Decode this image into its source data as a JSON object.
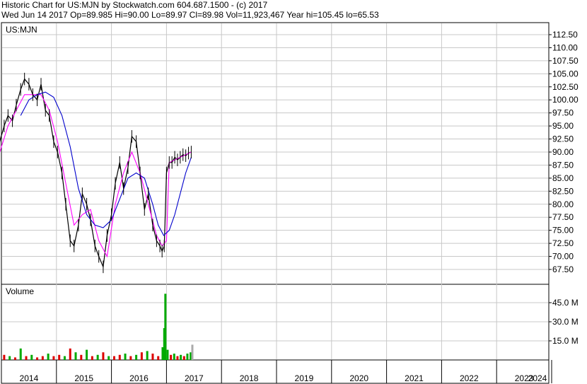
{
  "header": {
    "line1": "Historic Chart for US:MJN by Stockwatch.com 604.687.1500 - (c) 2017",
    "line2": "Wed Jun 14 2017   Op=89.985  Hi=90.00  Lo=89.97  Cl=89.98  Vol=11,923,467  Year hi=105.45  lo=65.53"
  },
  "colors": {
    "price": "#000000",
    "ma_short": "#ff00ff",
    "ma_long": "#0000cc",
    "volume_up": "#00aa00",
    "volume_down": "#dd0000",
    "volume_last": "#aaaaaa",
    "grid": "#c8c8c8"
  },
  "chart_data": [
    {
      "type": "line",
      "title": "US:MJN",
      "ylim": [
        65.53,
        113.5
      ],
      "yticks": [
        "112.50",
        "110.00",
        "107.50",
        "105.00",
        "102.50",
        "100.00",
        "97.50",
        "95.00",
        "92.50",
        "90.00",
        "87.50",
        "85.00",
        "82.50",
        "80.00",
        "77.50",
        "75.00",
        "72.50",
        "70.00",
        "67.50"
      ],
      "x_labels": [
        "2014",
        "2015",
        "2016",
        "2017",
        "2018",
        "2019",
        "2020",
        "2021",
        "2022",
        "2023",
        "2024"
      ],
      "series": [
        {
          "role": "price",
          "x": [
            2013.83,
            2013.9,
            2013.97,
            2014.05,
            2014.12,
            2014.2,
            2014.27,
            2014.35,
            2014.42,
            2014.5,
            2014.57,
            2014.65,
            2014.72,
            2014.8,
            2014.87,
            2014.95,
            2015.02,
            2015.1,
            2015.17,
            2015.25,
            2015.32,
            2015.4,
            2015.47,
            2015.55,
            2015.62,
            2015.7,
            2015.77,
            2015.85,
            2015.92,
            2016.0,
            2016.07,
            2016.15,
            2016.22,
            2016.3,
            2016.37,
            2016.45,
            2016.52,
            2016.6,
            2016.67,
            2016.75,
            2016.82,
            2016.88,
            2016.92,
            2016.96,
            2017.0,
            2017.05,
            2017.1,
            2017.15,
            2017.2,
            2017.25,
            2017.3,
            2017.35,
            2017.4,
            2017.45
          ],
          "y": [
            86,
            88,
            92,
            95,
            97,
            96,
            99,
            102,
            104,
            103,
            101,
            100,
            103,
            98,
            97,
            92,
            90,
            86,
            80,
            73,
            72,
            76,
            82,
            80,
            77,
            72,
            70,
            68,
            74,
            78,
            84,
            88,
            83,
            87,
            93,
            92,
            86,
            79,
            82,
            76,
            73,
            72,
            71,
            72,
            86,
            88,
            88,
            89,
            88.5,
            89,
            89.5,
            89.3,
            89.8,
            90
          ]
        },
        {
          "role": "ma_short",
          "x": [
            2013.83,
            2013.97,
            2014.12,
            2014.27,
            2014.42,
            2014.57,
            2014.72,
            2014.87,
            2015.02,
            2015.17,
            2015.32,
            2015.47,
            2015.62,
            2015.77,
            2015.92,
            2016.07,
            2016.22,
            2016.37,
            2016.52,
            2016.67,
            2016.82,
            2016.92,
            2017.0,
            2017.05,
            2017.15,
            2017.25,
            2017.35,
            2017.45
          ],
          "y": [
            85,
            90,
            95,
            98,
            101,
            101,
            101,
            98,
            92,
            84,
            76,
            78,
            79,
            73,
            70,
            80,
            86,
            90,
            86,
            80,
            74,
            72,
            73,
            88,
            88.5,
            89,
            89.5,
            90
          ]
        },
        {
          "role": "ma_long",
          "x": [
            2014.35,
            2014.5,
            2014.65,
            2014.8,
            2014.95,
            2015.1,
            2015.25,
            2015.4,
            2015.55,
            2015.7,
            2015.85,
            2016.0,
            2016.15,
            2016.3,
            2016.45,
            2016.6,
            2016.75,
            2016.85,
            2016.95,
            2017.05,
            2017.15,
            2017.25,
            2017.35,
            2017.45
          ],
          "y": [
            97,
            100,
            101,
            101.5,
            100.5,
            97,
            91,
            83,
            78,
            76,
            75.5,
            77,
            81,
            85,
            86,
            85,
            80,
            76,
            74,
            75,
            78,
            82,
            86,
            89
          ]
        }
      ]
    },
    {
      "type": "bar",
      "title": "Volume",
      "ylim": [
        0,
        55
      ],
      "yticks": [
        "45.0 M",
        "30.0 M",
        "15.0 M"
      ],
      "x": [
        2013.85,
        2013.95,
        2014.05,
        2014.15,
        2014.25,
        2014.35,
        2014.45,
        2014.55,
        2014.65,
        2014.75,
        2014.85,
        2014.95,
        2015.05,
        2015.15,
        2015.25,
        2015.35,
        2015.45,
        2015.55,
        2015.65,
        2015.75,
        2015.85,
        2015.95,
        2016.05,
        2016.15,
        2016.25,
        2016.35,
        2016.45,
        2016.55,
        2016.65,
        2016.75,
        2016.85,
        2016.93,
        2016.96,
        2016.98,
        2017.02,
        2017.08,
        2017.14,
        2017.2,
        2017.26,
        2017.32,
        2017.38,
        2017.44,
        2017.47
      ],
      "values": [
        3,
        2,
        4,
        3,
        2,
        9,
        3,
        4,
        2,
        3,
        5,
        3,
        4,
        3,
        9,
        6,
        4,
        8,
        3,
        4,
        6,
        3,
        3,
        4,
        5,
        3,
        4,
        6,
        7,
        5,
        3,
        10,
        25,
        52,
        8,
        4,
        5,
        3,
        4,
        3,
        5,
        6,
        12
      ],
      "direction": [
        "down",
        "up",
        "down",
        "up",
        "down",
        "up",
        "down",
        "up",
        "down",
        "down",
        "up",
        "down",
        "down",
        "up",
        "down",
        "up",
        "down",
        "up",
        "down",
        "up",
        "down",
        "up",
        "down",
        "down",
        "up",
        "down",
        "up",
        "down",
        "up",
        "down",
        "down",
        "up",
        "up",
        "up",
        "up",
        "down",
        "up",
        "down",
        "up",
        "down",
        "up",
        "up",
        "last"
      ]
    }
  ]
}
